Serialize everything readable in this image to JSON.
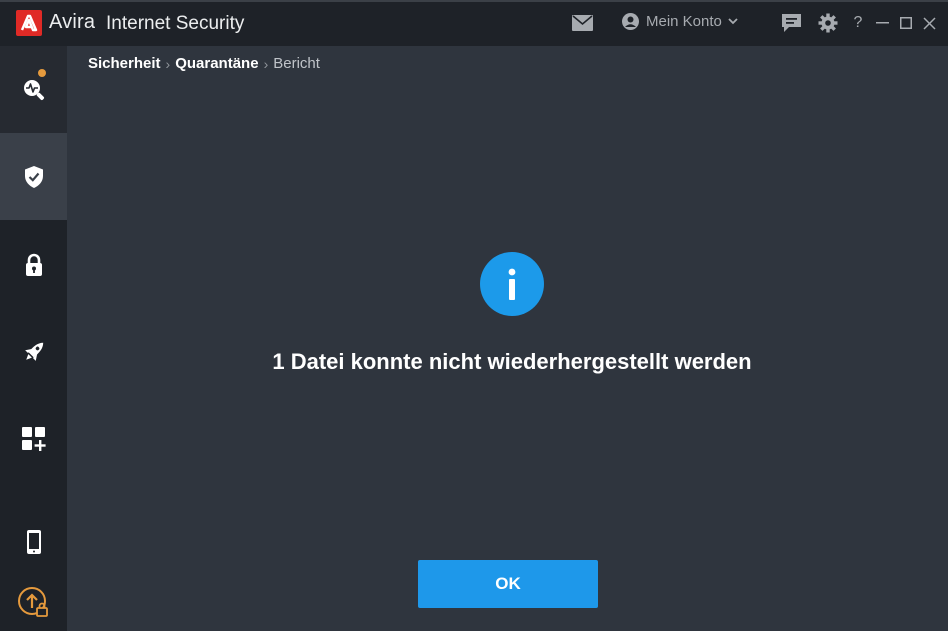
{
  "titlebar": {
    "brand": "Avira",
    "product": "Internet Security",
    "account_label": "Mein Konto",
    "help_label": "?",
    "icons": [
      "avira-logo-icon",
      "mail-icon",
      "user-icon",
      "chevron-down-icon",
      "feedback-icon",
      "gear-icon",
      "minimize-icon",
      "maximize-icon",
      "close-icon"
    ]
  },
  "sidebar": {
    "items": [
      {
        "name": "scanner",
        "icon": "scan-icon",
        "has_notification": true
      },
      {
        "name": "security",
        "icon": "shield-check-icon",
        "active": true
      },
      {
        "name": "privacy",
        "icon": "lock-icon"
      },
      {
        "name": "performance",
        "icon": "rocket-icon"
      },
      {
        "name": "apps",
        "icon": "apps-add-icon"
      },
      {
        "name": "mobile",
        "icon": "phone-icon"
      },
      {
        "name": "upgrade",
        "icon": "upgrade-icon"
      }
    ]
  },
  "breadcrumb": {
    "items": [
      "Sicherheit",
      "Quarantäne",
      "Bericht"
    ],
    "separator": "›"
  },
  "dialog": {
    "icon": "info-icon",
    "message": "1 Datei konnte nicht wiederhergestellt werden",
    "ok_label": "OK"
  },
  "colors": {
    "background": "#2f353e",
    "sidebar": "#1e2228",
    "accent": "#1c9aea",
    "brand_red": "#e02a26",
    "upgrade_orange": "#e59a3d"
  }
}
